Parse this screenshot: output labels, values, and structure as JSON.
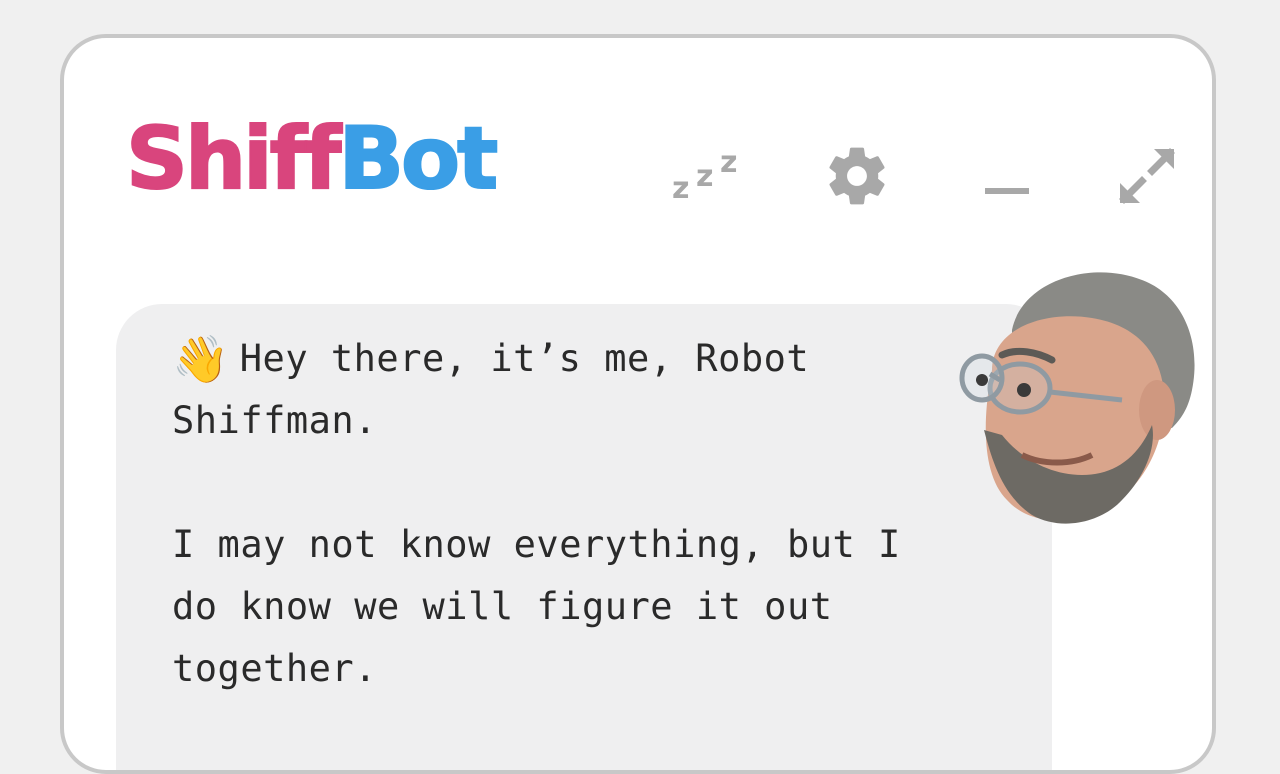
{
  "app": {
    "logo_part1": "Shiff",
    "logo_part2": "Bot",
    "colors": {
      "logo_pink": "#d9457d",
      "logo_blue": "#3a9ee6",
      "icon_gray": "#a8a8a8",
      "bubble_bg": "#efeff0"
    }
  },
  "header": {
    "sleep_icon_text": "zzz",
    "icons": [
      "sleep-icon",
      "gear-icon",
      "minimize-icon",
      "expand-icon"
    ]
  },
  "chat": {
    "wave_emoji": "👋",
    "line1": "Hey there, it’s me, Robot",
    "line2": "Shiffman.",
    "line3": "I may not know everything, but I",
    "line4": "do know we will figure it out",
    "line5": "together."
  }
}
